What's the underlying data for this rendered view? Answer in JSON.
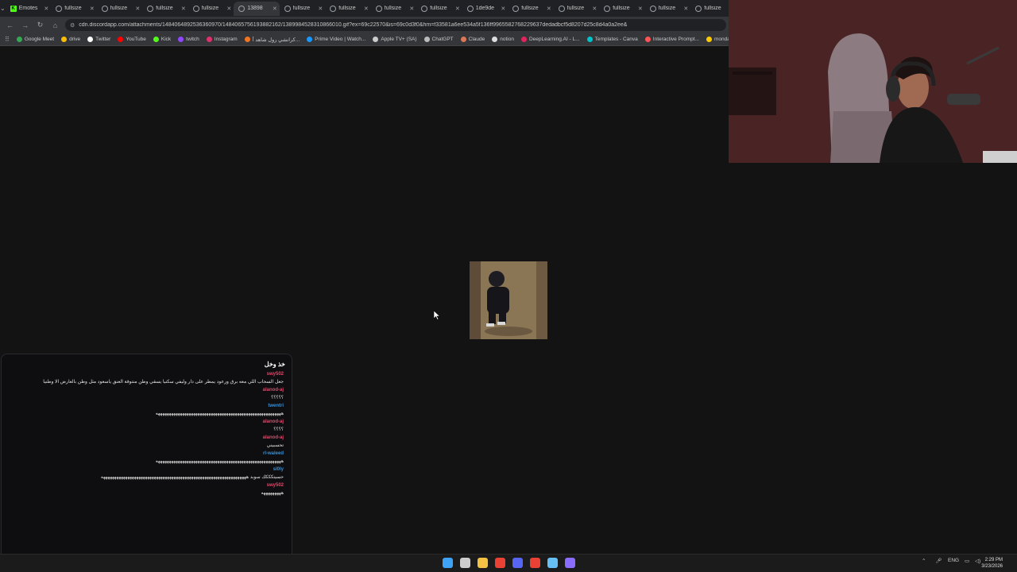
{
  "tabs": [
    {
      "label": "Emotes",
      "active": false,
      "icon": "kick-icon"
    },
    {
      "label": "fullsize",
      "active": false,
      "icon": "globe-icon"
    },
    {
      "label": "fullsize",
      "active": false,
      "icon": "globe-icon"
    },
    {
      "label": "fullsize",
      "active": false,
      "icon": "globe-icon"
    },
    {
      "label": "fullsize",
      "active": false,
      "icon": "globe-icon"
    },
    {
      "label": "13898",
      "active": true,
      "icon": "globe-icon"
    },
    {
      "label": "fullsize",
      "active": false,
      "icon": "globe-icon"
    },
    {
      "label": "fullsize",
      "active": false,
      "icon": "globe-icon"
    },
    {
      "label": "fullsize",
      "active": false,
      "icon": "globe-icon"
    },
    {
      "label": "fullsize",
      "active": false,
      "icon": "globe-icon"
    },
    {
      "label": "1de9de",
      "active": false,
      "icon": "globe-icon"
    },
    {
      "label": "fullsize",
      "active": false,
      "icon": "globe-icon"
    },
    {
      "label": "fullsize",
      "active": false,
      "icon": "globe-icon"
    },
    {
      "label": "fullsize",
      "active": false,
      "icon": "globe-icon"
    },
    {
      "label": "fullsize",
      "active": false,
      "icon": "globe-icon"
    },
    {
      "label": "fullsize",
      "active": false,
      "icon": "globe-icon"
    }
  ],
  "address": {
    "url": "cdn.discordapp.com/attachments/1484064892536360970/1484065756193882162/1389984528310866010.gif?ex=69c22570&is=69c0d3f0&hm=f33581a6ee534a5f136ff9965582768229637dedadbcf5d8207d25c8d4a0a2ee&"
  },
  "bookmarks": [
    {
      "label": "Google Meet",
      "color": "#34a853"
    },
    {
      "label": "drive",
      "color": "#fbbc04"
    },
    {
      "label": "Twitter",
      "color": "#ffffff"
    },
    {
      "label": "YouTube",
      "color": "#ff0000"
    },
    {
      "label": "Kick",
      "color": "#53fc18"
    },
    {
      "label": "twitch",
      "color": "#9146ff"
    },
    {
      "label": "Instagram",
      "color": "#e1306c"
    },
    {
      "label": "كرانشي رول شاهد أ...",
      "color": "#f47521"
    },
    {
      "label": "Prime Video | Watch...",
      "color": "#1a98ff"
    },
    {
      "label": "Apple TV+ (SA)",
      "color": "#cccccc"
    },
    {
      "label": "ChatGPT",
      "color": "#bbbbbb"
    },
    {
      "label": "Claude",
      "color": "#d97757"
    },
    {
      "label": "notion",
      "color": "#dddddd"
    },
    {
      "label": "DeepLearning.AI - L...",
      "color": "#e0245e"
    },
    {
      "label": "Templates - Canva",
      "color": "#00c4cc"
    },
    {
      "label": "Interactive Prompt...",
      "color": "#ff5555"
    },
    {
      "label": "monday.com | Out",
      "color": "#ffcb00"
    }
  ],
  "chat": {
    "title": "خذ وخل",
    "messages": [
      {
        "user": "swy502",
        "text": "جعل السحاب اللي معه برق ورعود يمطر على دار وليفي سكنيا يسقي وطن منتوقة العنق ياسعود مثل وطن بالعارض الا وطنيا",
        "color": "#e5466b"
      },
      {
        "user": "alanod-aj",
        "text": "؟؟؟؟؟",
        "color": "#e5466b"
      },
      {
        "user": "twentri",
        "text": "هههههههههههههههههههههههههههههههههههههههههههههههههههههههههه",
        "color": "#3b8fd4"
      },
      {
        "user": "alanod-aj",
        "text": "؟؟؟؟",
        "color": "#e5466b"
      },
      {
        "user": "alanod-aj",
        "text": "تحسبيني",
        "color": "#e5466b"
      },
      {
        "user": "rl-waleed",
        "text": "هههههههههههههههههههههههههههههههههههههههههههههههههههههههههه",
        "color": "#3b8fd4"
      },
      {
        "user": "sl0ly",
        "text": "حسيتكككك سوبد ههههههههههههههههههههههههههههههههههههههههههههههههههههههههههههههههههه",
        "color": "#3b8fd4"
      },
      {
        "user": "swy502",
        "text": "هههههههههه",
        "color": "#e5466b"
      }
    ]
  },
  "taskbar": {
    "apps": [
      {
        "name": "windows-start-icon",
        "color": "#3ea3f5"
      },
      {
        "name": "search-icon",
        "color": "#cccccc"
      },
      {
        "name": "file-explorer-icon",
        "color": "#f3c245"
      },
      {
        "name": "chrome-icon",
        "color": "#e94235"
      },
      {
        "name": "discord-icon",
        "color": "#5865f2"
      },
      {
        "name": "chrome-icon-2",
        "color": "#e94235"
      },
      {
        "name": "steam-icon",
        "color": "#66c0f4"
      },
      {
        "name": "app-icon",
        "color": "#8a6cff"
      }
    ],
    "language": "ENG",
    "time": "2:29 PM",
    "date": "3/23/2026"
  }
}
